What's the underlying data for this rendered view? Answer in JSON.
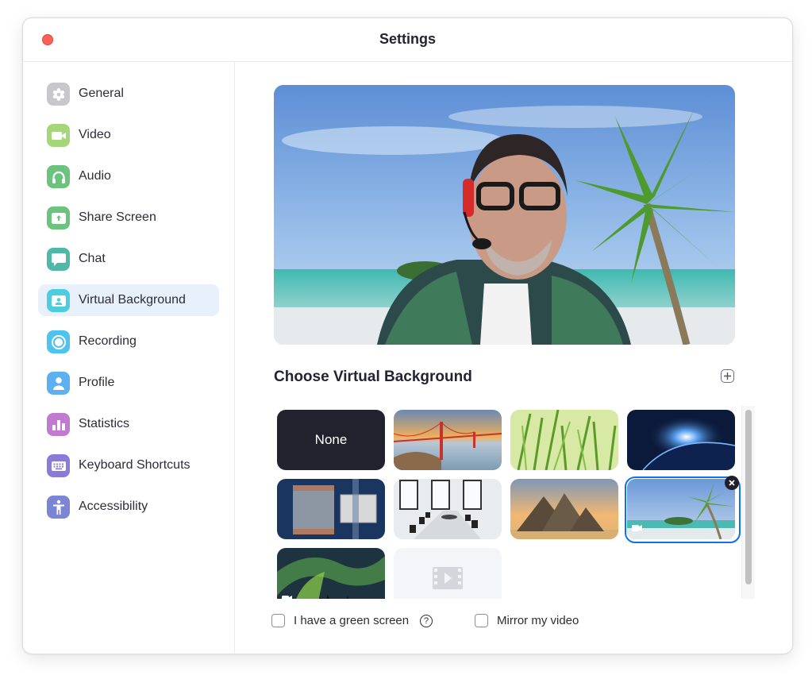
{
  "window": {
    "title": "Settings",
    "close_color": "#fe5f57"
  },
  "sidebar": {
    "active_index": 5,
    "items": [
      {
        "label": "General",
        "icon": "gear-icon",
        "color": "#c8c8cc"
      },
      {
        "label": "Video",
        "icon": "video-camera-icon",
        "color": "#a6d67a"
      },
      {
        "label": "Audio",
        "icon": "headphones-icon",
        "color": "#6cc37d"
      },
      {
        "label": "Share Screen",
        "icon": "share-screen-icon",
        "color": "#6cc37d"
      },
      {
        "label": "Chat",
        "icon": "chat-bubble-icon",
        "color": "#4fb8a6"
      },
      {
        "label": "Virtual Background",
        "icon": "virtual-background-icon",
        "color": "#4fcde0"
      },
      {
        "label": "Recording",
        "icon": "record-icon",
        "color": "#4fc3f0"
      },
      {
        "label": "Profile",
        "icon": "profile-icon",
        "color": "#5db1f0"
      },
      {
        "label": "Statistics",
        "icon": "bar-chart-icon",
        "color": "#c07ad0"
      },
      {
        "label": "Keyboard Shortcuts",
        "icon": "keyboard-icon",
        "color": "#8b7ad6"
      },
      {
        "label": "Accessibility",
        "icon": "accessibility-icon",
        "color": "#7b85d4"
      }
    ]
  },
  "main": {
    "preview_label": "Camera preview with beach background",
    "section_title": "Choose Virtual Background",
    "add_button_label": "+",
    "backgrounds": [
      {
        "label": "None",
        "kind": "none"
      },
      {
        "label": "Golden Gate Bridge",
        "kind": "image"
      },
      {
        "label": "Grass",
        "kind": "image"
      },
      {
        "label": "Earth from space",
        "kind": "image"
      },
      {
        "label": "Stage",
        "kind": "image"
      },
      {
        "label": "Conference room",
        "kind": "image"
      },
      {
        "label": "Pyramids",
        "kind": "image"
      },
      {
        "label": "Beach",
        "kind": "video",
        "selected": true
      },
      {
        "label": "Aurora",
        "kind": "video"
      },
      {
        "label": "Video placeholder",
        "kind": "placeholder"
      }
    ],
    "selected_index": 7,
    "accent_color": "#0e72ed",
    "green_screen_label": "I have a green screen",
    "green_screen_checked": false,
    "help_glyph": "?",
    "mirror_label": "Mirror my video",
    "mirror_checked": false
  }
}
